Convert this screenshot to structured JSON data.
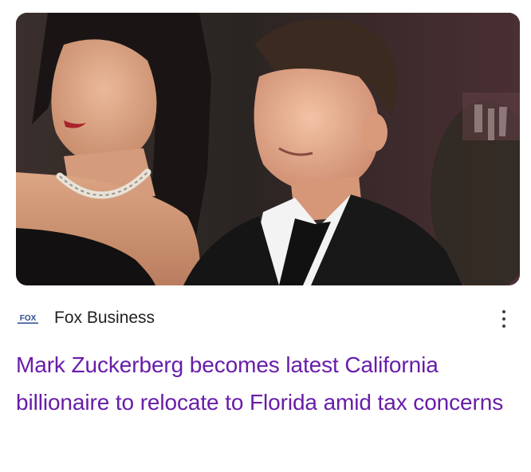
{
  "card": {
    "image_alt": "",
    "source": {
      "logo_icon": "fox-business-logo-icon",
      "logo_text": "FOX",
      "name": "Fox Business"
    },
    "menu_icon": "more-vert-icon",
    "headline": "Mark Zuckerberg becomes latest California billionaire to relocate to Florida amid tax concerns"
  },
  "colors": {
    "headline_visited": "#681da8",
    "source_text": "#202124",
    "logo_blue": "#2c4a8f"
  }
}
